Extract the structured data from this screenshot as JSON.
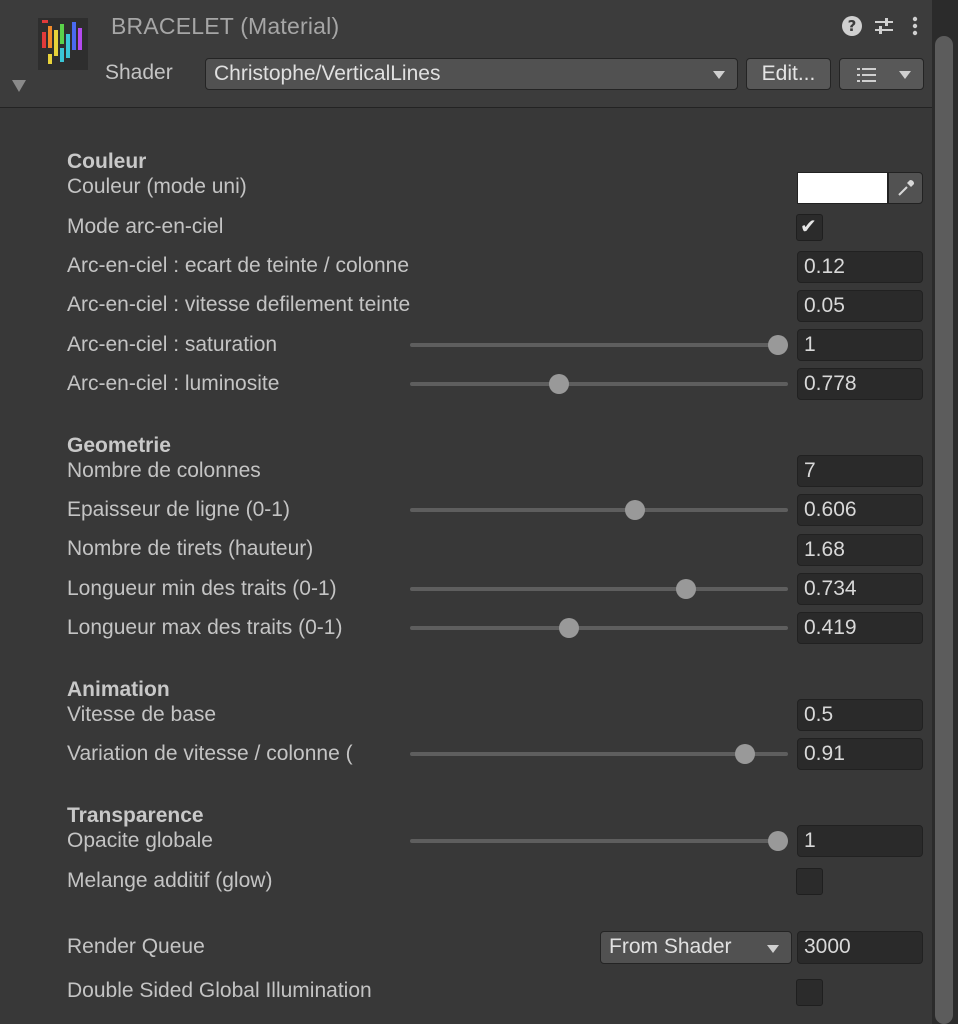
{
  "header": {
    "title": "BRACELET (Material)",
    "shader_label": "Shader",
    "shader_value": "Christophe/VerticalLines",
    "edit_button": "Edit...",
    "icons": [
      "help-icon",
      "settings-sliders-icon",
      "more-vertical-icon",
      "list-icon"
    ]
  },
  "sections": {
    "couleur": "Couleur",
    "geometrie": "Geometrie",
    "animation": "Animation",
    "transparence": "Transparence"
  },
  "props": {
    "couleur_uni": {
      "label": "Couleur (mode uni)",
      "color": "#ffffff"
    },
    "mode_arc": {
      "label": "Mode arc-en-ciel",
      "checked": true
    },
    "ecart": {
      "label": "Arc-en-ciel : ecart de teinte / colonne",
      "value": "0.12"
    },
    "vitesse_def": {
      "label": "Arc-en-ciel : vitesse defilement teinte",
      "value": "0.05"
    },
    "saturation": {
      "label": "Arc-en-ciel : saturation",
      "value": "1",
      "slider": 1.0
    },
    "luminosite": {
      "label": "Arc-en-ciel : luminosite",
      "value": "0.778",
      "slider": 0.4
    },
    "nb_colonnes": {
      "label": "Nombre de colonnes",
      "value": "7"
    },
    "epaisseur": {
      "label": "Epaisseur de ligne (0-1)",
      "value": "0.606",
      "slider": 0.6
    },
    "nb_tirets": {
      "label": "Nombre de tirets (hauteur)",
      "value": "1.68"
    },
    "long_min": {
      "label": "Longueur min des traits (0-1)",
      "value": "0.734",
      "slider": 0.734
    },
    "long_max": {
      "label": "Longueur max des traits (0-1)",
      "value": "0.419",
      "slider": 0.419
    },
    "vitesse_base": {
      "label": "Vitesse de base",
      "value": "0.5"
    },
    "variation": {
      "label": "Variation de vitesse / colonne (",
      "value": "0.91",
      "slider": 0.91
    },
    "opacite": {
      "label": "Opacite globale",
      "value": "1",
      "slider": 1.0
    },
    "melange": {
      "label": "Melange additif (glow)",
      "checked": false
    }
  },
  "render_queue": {
    "label": "Render Queue",
    "mode": "From Shader",
    "value": "3000"
  },
  "double_sided": {
    "label": "Double Sided Global Illumination",
    "checked": false
  }
}
